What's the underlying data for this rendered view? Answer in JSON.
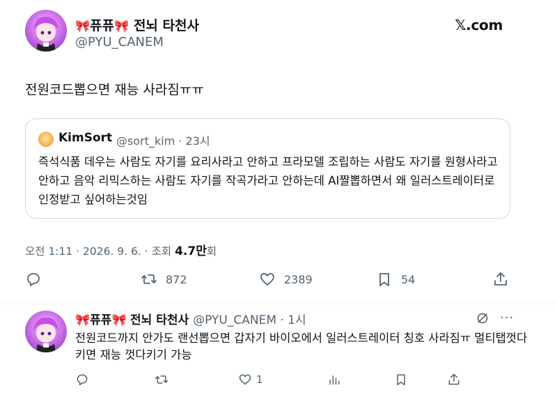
{
  "tweet": {
    "author_name": "전뇌 타천사",
    "bow_glyph": "🎀",
    "name_prefix": "퓨퓨",
    "handle": "@PYU_CANEM",
    "source_label": "𝕏.com",
    "text": "전원코드뽑으면 재능 사라짐ㅠㅠ",
    "timestamp": "오전 1:11 · 2026. 9. 6. · 조회 ",
    "views": "4.7만",
    "views_suffix": "회"
  },
  "quote": {
    "author_name": "KimSort",
    "handle_meta": "@sort_kim · 23시",
    "text": "즉석식품 데우는 사람도 자기를 요리사라고 안하고 프라모델 조립하는 사람도 자기를 원형사라고 안하고 음악 리믹스하는 사람도 자기를 작곡가라고 안하는데 AI짤뽑하면서 왜 일러스트레이터로 인정받고 싶어하는것임"
  },
  "actions": {
    "reply_count": "",
    "retweet_count": "872",
    "like_count": "2389",
    "bookmark_count": "54"
  },
  "reply": {
    "author_name": "전뇌 타천사",
    "name_prefix": "퓨퓨",
    "handle_meta": "@PYU_CANEM · 1시",
    "more_glyph": "···",
    "text": "전원코드까지 안가도 랜선뽑으면 갑자기 바이오에서 일러스트레이터 칭호 사라짐ㅠ 멀티탭껏다키면 재능 껏다키기 가능",
    "like_count": "1"
  },
  "icons": {
    "reply": "speech-bubble-icon",
    "retweet": "retweet-icon",
    "like": "heart-icon",
    "bookmark": "bookmark-icon",
    "share": "share-icon",
    "views": "bar-chart-icon",
    "grok": "grok-icon"
  },
  "colors": {
    "text_primary": "#0f1419",
    "text_secondary": "#536471",
    "border": "#cfd9de",
    "bow": "#e75c8a"
  }
}
